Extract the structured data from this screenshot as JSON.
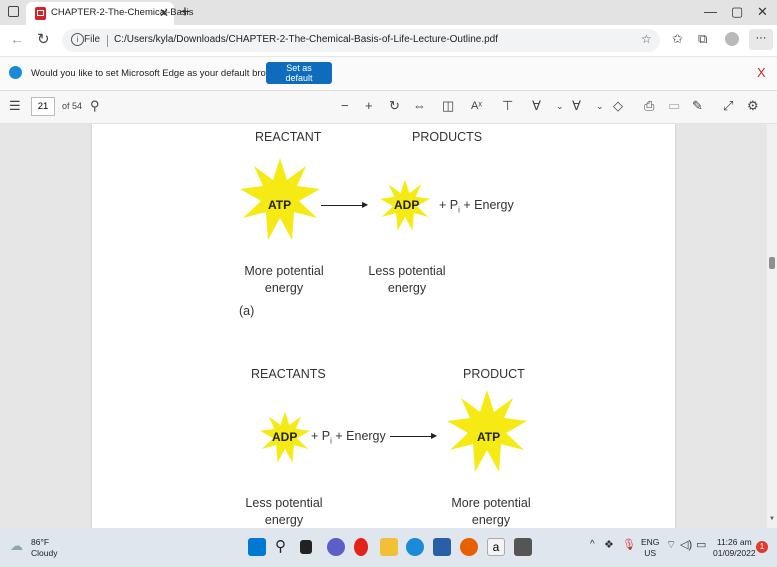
{
  "browser": {
    "tab_title": "CHAPTER-2-The-Chemical-Basis",
    "new_tab": "+",
    "file_label": "File",
    "url": "C:/Users/kyla/Downloads/CHAPTER-2-The-Chemical-Basis-of-Life-Lecture-Outline.pdf",
    "more": "···"
  },
  "infobar": {
    "message": "Would you like to set Microsoft Edge as your default browser?",
    "button": "Set as default",
    "close": "X"
  },
  "pdf_toolbar": {
    "page": "21",
    "total": "of 54"
  },
  "figure_a": {
    "reactant_label": "REACTANT",
    "products_label": "PRODUCTS",
    "left_star": "ATP",
    "right_star": "ADP",
    "extra": "+ P",
    "extra_sub": "i",
    "extra_rest": " + Energy",
    "left_caption": [
      "More potential",
      "energy"
    ],
    "right_caption": [
      "Less potential",
      "energy"
    ],
    "tag": "(a)"
  },
  "figure_b": {
    "reactant_label": "REACTANTS",
    "product_label": "PRODUCT",
    "left_star": "ADP",
    "right_star": "ATP",
    "extra": "+ P",
    "extra_sub": "i",
    "extra_rest": " + Energy",
    "left_caption": [
      "Less potential",
      "energy"
    ],
    "right_caption": [
      "More potential",
      "energy"
    ]
  },
  "taskbar": {
    "weather_temp": "86°F",
    "weather_desc": "Cloudy",
    "lang1": "ENG",
    "lang2": "US",
    "time": "11:26 am",
    "date": "01/09/2022",
    "notif": "1"
  },
  "colors": {
    "star_fill": "#f5ea14",
    "edge_blue": "#0f6cbd",
    "pdf_red": "#d2232a"
  }
}
